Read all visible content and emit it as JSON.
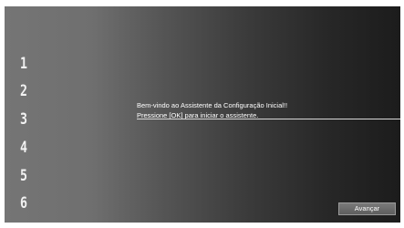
{
  "steps": [
    "1",
    "2",
    "3",
    "4",
    "5",
    "6"
  ],
  "message": {
    "line1": "Bem-vindo ao Assistente da Configuração Inicial!!",
    "line2": "Pressione [OK] para iniciar o assistente."
  },
  "buttons": {
    "next_label": "Avançar"
  }
}
